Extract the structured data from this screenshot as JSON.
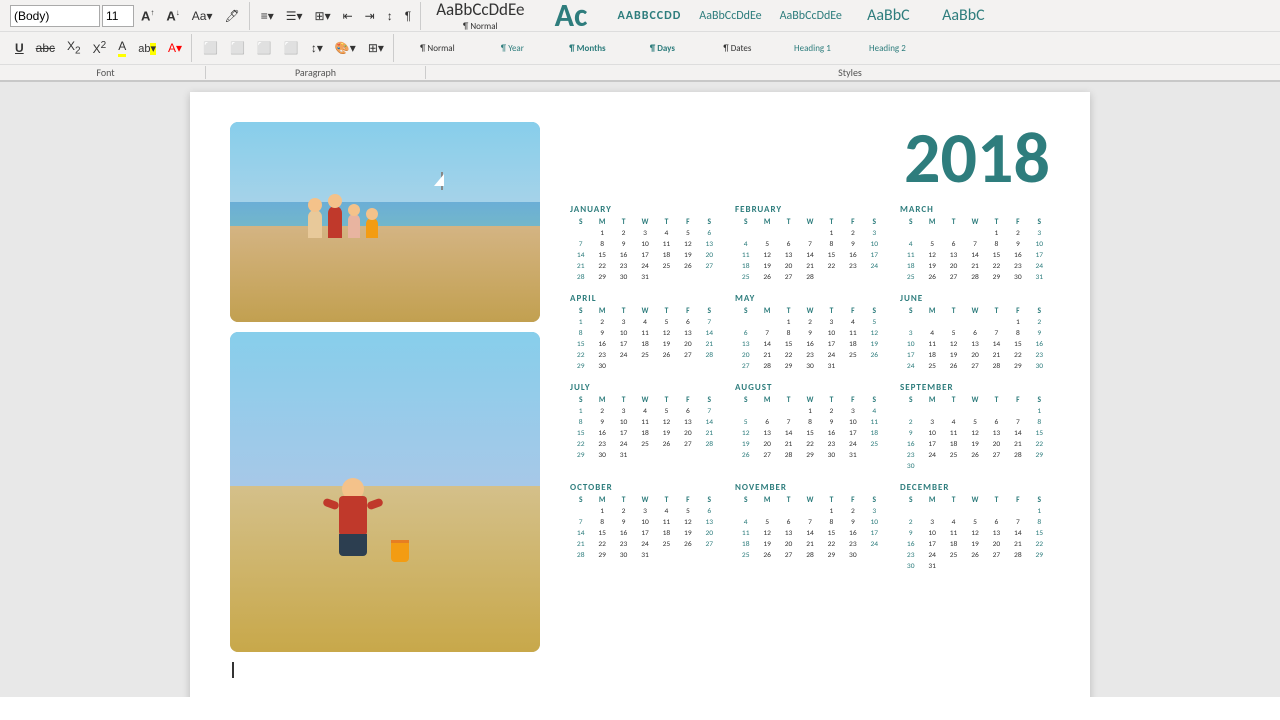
{
  "toolbar": {
    "font_name": "(Body)",
    "font_size": "11",
    "row1_buttons": [
      "A↑",
      "A↓",
      "Aa▼",
      "🖊"
    ],
    "row2_buttons": [
      "U",
      "abc",
      "X₂",
      "X²",
      "A▼",
      "ab▼",
      "A▼"
    ],
    "alignment": [
      "⬛",
      "⬛",
      "⬛",
      "⬛"
    ],
    "paragraph_label": "Paragraph",
    "font_label": "Font"
  },
  "styles_bar": {
    "items": [
      {
        "id": "normal",
        "label": "Normal",
        "preview_text": "¶ Normal",
        "style_class": "style-preview-normal"
      },
      {
        "id": "year",
        "label": "Year",
        "preview_text": "¶ Year",
        "style_class": "style-preview-year"
      },
      {
        "id": "months",
        "label": "Months",
        "preview_text": "¶ Months",
        "style_class": "style-preview-months"
      },
      {
        "id": "days",
        "label": "Days",
        "preview_text": "¶ Days",
        "style_class": "style-preview-days"
      },
      {
        "id": "dates",
        "label": "Dates",
        "preview_text": "¶ Dates",
        "style_class": "style-preview-dates"
      },
      {
        "id": "heading1",
        "label": "Heading 1",
        "preview_text": "AaBbCcDdEe",
        "style_class": "style-preview-h1"
      },
      {
        "id": "heading2",
        "label": "Heading 2",
        "preview_text": "AaBbCc",
        "style_class": "style-preview-h2"
      }
    ],
    "section_label": "Styles"
  },
  "year": "2018",
  "months": [
    {
      "name": "JANUARY",
      "days": [
        "S",
        "M",
        "T",
        "W",
        "T",
        "F",
        "S"
      ],
      "weeks": [
        [
          "",
          "",
          "",
          "",
          "",
          "",
          "1"
        ],
        [
          "",
          "",
          "",
          "",
          "",
          "",
          ""
        ],
        [
          "",
          "",
          "",
          "",
          "",
          "",
          ""
        ],
        [
          "",
          "",
          "",
          "",
          "",
          "",
          ""
        ],
        [
          "",
          "",
          "",
          "",
          "",
          "",
          ""
        ]
      ],
      "dates": [
        [
          null,
          1,
          2,
          3,
          4,
          5,
          6
        ],
        [
          7,
          8,
          9,
          10,
          11,
          12,
          13
        ],
        [
          14,
          15,
          16,
          17,
          18,
          19,
          20
        ],
        [
          21,
          22,
          23,
          24,
          25,
          26,
          27
        ],
        [
          28,
          29,
          30,
          31,
          null,
          null,
          null
        ]
      ]
    },
    {
      "name": "FEBRUARY",
      "dates": [
        [
          null,
          null,
          null,
          null,
          1,
          2,
          3
        ],
        [
          4,
          5,
          6,
          7,
          8,
          9,
          10
        ],
        [
          11,
          12,
          13,
          14,
          15,
          16,
          17
        ],
        [
          18,
          19,
          20,
          21,
          22,
          23,
          24
        ],
        [
          25,
          26,
          27,
          28,
          null,
          null,
          null
        ]
      ]
    },
    {
      "name": "MARCH",
      "dates": [
        [
          null,
          null,
          null,
          null,
          1,
          2,
          3
        ],
        [
          4,
          5,
          6,
          7,
          8,
          9,
          10
        ],
        [
          11,
          12,
          13,
          14,
          15,
          16,
          17
        ],
        [
          18,
          19,
          20,
          21,
          22,
          23,
          24
        ],
        [
          25,
          26,
          27,
          28,
          29,
          30,
          31
        ]
      ]
    },
    {
      "name": "APRIL",
      "dates": [
        [
          1,
          2,
          3,
          4,
          5,
          6,
          7
        ],
        [
          8,
          9,
          10,
          11,
          12,
          13,
          14
        ],
        [
          15,
          16,
          17,
          18,
          19,
          20,
          21
        ],
        [
          22,
          23,
          24,
          25,
          26,
          27,
          28
        ],
        [
          29,
          30,
          null,
          null,
          null,
          null,
          null
        ]
      ]
    },
    {
      "name": "MAY",
      "dates": [
        [
          null,
          null,
          1,
          2,
          3,
          4,
          5
        ],
        [
          6,
          7,
          8,
          9,
          10,
          11,
          12
        ],
        [
          13,
          14,
          15,
          16,
          17,
          18,
          19
        ],
        [
          20,
          21,
          22,
          23,
          24,
          25,
          26
        ],
        [
          27,
          28,
          29,
          30,
          31,
          null,
          null
        ]
      ]
    },
    {
      "name": "JUNE",
      "dates": [
        [
          null,
          null,
          null,
          null,
          null,
          1,
          2
        ],
        [
          3,
          4,
          5,
          6,
          7,
          8,
          9
        ],
        [
          10,
          11,
          12,
          13,
          14,
          15,
          16
        ],
        [
          17,
          18,
          19,
          20,
          21,
          22,
          23
        ],
        [
          24,
          25,
          26,
          27,
          28,
          29,
          30
        ]
      ]
    },
    {
      "name": "JULY",
      "dates": [
        [
          1,
          2,
          3,
          4,
          5,
          6,
          7
        ],
        [
          8,
          9,
          10,
          11,
          12,
          13,
          14
        ],
        [
          15,
          16,
          17,
          18,
          19,
          20,
          21
        ],
        [
          22,
          23,
          24,
          25,
          26,
          27,
          28
        ],
        [
          29,
          30,
          31,
          null,
          null,
          null,
          null
        ]
      ]
    },
    {
      "name": "AUGUST",
      "dates": [
        [
          null,
          null,
          null,
          1,
          2,
          3,
          4
        ],
        [
          5,
          6,
          7,
          8,
          9,
          10,
          11
        ],
        [
          12,
          13,
          14,
          15,
          16,
          17,
          18
        ],
        [
          19,
          20,
          21,
          22,
          23,
          24,
          25
        ],
        [
          26,
          27,
          28,
          29,
          30,
          31,
          null
        ]
      ]
    },
    {
      "name": "SEPTEMBER",
      "dates": [
        [
          null,
          null,
          null,
          null,
          null,
          null,
          1
        ],
        [
          2,
          3,
          4,
          5,
          6,
          7,
          8
        ],
        [
          9,
          10,
          11,
          12,
          13,
          14,
          15
        ],
        [
          16,
          17,
          18,
          19,
          20,
          21,
          22
        ],
        [
          23,
          24,
          25,
          26,
          27,
          28,
          29
        ],
        [
          30,
          null,
          null,
          null,
          null,
          null,
          null
        ]
      ]
    },
    {
      "name": "OCTOBER",
      "dates": [
        [
          null,
          1,
          2,
          3,
          4,
          5,
          6
        ],
        [
          7,
          8,
          9,
          10,
          11,
          12,
          13
        ],
        [
          14,
          15,
          16,
          17,
          18,
          19,
          20
        ],
        [
          21,
          22,
          23,
          24,
          25,
          26,
          27
        ],
        [
          28,
          29,
          30,
          31,
          null,
          null,
          null
        ]
      ]
    },
    {
      "name": "NOVEMBER",
      "dates": [
        [
          null,
          null,
          null,
          null,
          1,
          2,
          3
        ],
        [
          4,
          5,
          6,
          7,
          8,
          9,
          10
        ],
        [
          11,
          12,
          13,
          14,
          15,
          16,
          17
        ],
        [
          18,
          19,
          20,
          21,
          22,
          23,
          24
        ],
        [
          25,
          26,
          27,
          28,
          29,
          30,
          null
        ]
      ]
    },
    {
      "name": "DECEMBER",
      "dates": [
        [
          null,
          null,
          null,
          null,
          null,
          null,
          1
        ],
        [
          2,
          3,
          4,
          5,
          6,
          7,
          8
        ],
        [
          9,
          10,
          11,
          12,
          13,
          14,
          15
        ],
        [
          16,
          17,
          18,
          19,
          20,
          21,
          22
        ],
        [
          23,
          24,
          25,
          26,
          27,
          28,
          29
        ],
        [
          30,
          31,
          null,
          null,
          null,
          null,
          null
        ]
      ]
    }
  ]
}
